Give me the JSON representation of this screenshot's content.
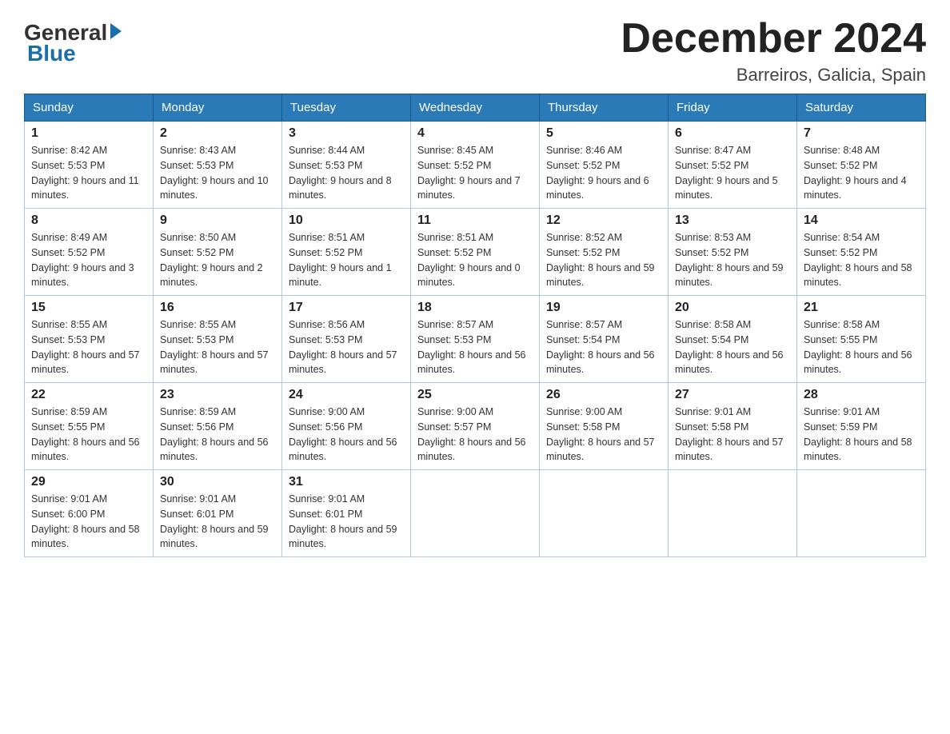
{
  "header": {
    "logo_general": "General",
    "logo_blue": "Blue",
    "month_title": "December 2024",
    "location": "Barreiros, Galicia, Spain"
  },
  "days_of_week": [
    "Sunday",
    "Monday",
    "Tuesday",
    "Wednesday",
    "Thursday",
    "Friday",
    "Saturday"
  ],
  "weeks": [
    [
      {
        "num": "1",
        "sunrise": "8:42 AM",
        "sunset": "5:53 PM",
        "daylight": "9 hours and 11 minutes."
      },
      {
        "num": "2",
        "sunrise": "8:43 AM",
        "sunset": "5:53 PM",
        "daylight": "9 hours and 10 minutes."
      },
      {
        "num": "3",
        "sunrise": "8:44 AM",
        "sunset": "5:53 PM",
        "daylight": "9 hours and 8 minutes."
      },
      {
        "num": "4",
        "sunrise": "8:45 AM",
        "sunset": "5:52 PM",
        "daylight": "9 hours and 7 minutes."
      },
      {
        "num": "5",
        "sunrise": "8:46 AM",
        "sunset": "5:52 PM",
        "daylight": "9 hours and 6 minutes."
      },
      {
        "num": "6",
        "sunrise": "8:47 AM",
        "sunset": "5:52 PM",
        "daylight": "9 hours and 5 minutes."
      },
      {
        "num": "7",
        "sunrise": "8:48 AM",
        "sunset": "5:52 PM",
        "daylight": "9 hours and 4 minutes."
      }
    ],
    [
      {
        "num": "8",
        "sunrise": "8:49 AM",
        "sunset": "5:52 PM",
        "daylight": "9 hours and 3 minutes."
      },
      {
        "num": "9",
        "sunrise": "8:50 AM",
        "sunset": "5:52 PM",
        "daylight": "9 hours and 2 minutes."
      },
      {
        "num": "10",
        "sunrise": "8:51 AM",
        "sunset": "5:52 PM",
        "daylight": "9 hours and 1 minute."
      },
      {
        "num": "11",
        "sunrise": "8:51 AM",
        "sunset": "5:52 PM",
        "daylight": "9 hours and 0 minutes."
      },
      {
        "num": "12",
        "sunrise": "8:52 AM",
        "sunset": "5:52 PM",
        "daylight": "8 hours and 59 minutes."
      },
      {
        "num": "13",
        "sunrise": "8:53 AM",
        "sunset": "5:52 PM",
        "daylight": "8 hours and 59 minutes."
      },
      {
        "num": "14",
        "sunrise": "8:54 AM",
        "sunset": "5:52 PM",
        "daylight": "8 hours and 58 minutes."
      }
    ],
    [
      {
        "num": "15",
        "sunrise": "8:55 AM",
        "sunset": "5:53 PM",
        "daylight": "8 hours and 57 minutes."
      },
      {
        "num": "16",
        "sunrise": "8:55 AM",
        "sunset": "5:53 PM",
        "daylight": "8 hours and 57 minutes."
      },
      {
        "num": "17",
        "sunrise": "8:56 AM",
        "sunset": "5:53 PM",
        "daylight": "8 hours and 57 minutes."
      },
      {
        "num": "18",
        "sunrise": "8:57 AM",
        "sunset": "5:53 PM",
        "daylight": "8 hours and 56 minutes."
      },
      {
        "num": "19",
        "sunrise": "8:57 AM",
        "sunset": "5:54 PM",
        "daylight": "8 hours and 56 minutes."
      },
      {
        "num": "20",
        "sunrise": "8:58 AM",
        "sunset": "5:54 PM",
        "daylight": "8 hours and 56 minutes."
      },
      {
        "num": "21",
        "sunrise": "8:58 AM",
        "sunset": "5:55 PM",
        "daylight": "8 hours and 56 minutes."
      }
    ],
    [
      {
        "num": "22",
        "sunrise": "8:59 AM",
        "sunset": "5:55 PM",
        "daylight": "8 hours and 56 minutes."
      },
      {
        "num": "23",
        "sunrise": "8:59 AM",
        "sunset": "5:56 PM",
        "daylight": "8 hours and 56 minutes."
      },
      {
        "num": "24",
        "sunrise": "9:00 AM",
        "sunset": "5:56 PM",
        "daylight": "8 hours and 56 minutes."
      },
      {
        "num": "25",
        "sunrise": "9:00 AM",
        "sunset": "5:57 PM",
        "daylight": "8 hours and 56 minutes."
      },
      {
        "num": "26",
        "sunrise": "9:00 AM",
        "sunset": "5:58 PM",
        "daylight": "8 hours and 57 minutes."
      },
      {
        "num": "27",
        "sunrise": "9:01 AM",
        "sunset": "5:58 PM",
        "daylight": "8 hours and 57 minutes."
      },
      {
        "num": "28",
        "sunrise": "9:01 AM",
        "sunset": "5:59 PM",
        "daylight": "8 hours and 58 minutes."
      }
    ],
    [
      {
        "num": "29",
        "sunrise": "9:01 AM",
        "sunset": "6:00 PM",
        "daylight": "8 hours and 58 minutes."
      },
      {
        "num": "30",
        "sunrise": "9:01 AM",
        "sunset": "6:01 PM",
        "daylight": "8 hours and 59 minutes."
      },
      {
        "num": "31",
        "sunrise": "9:01 AM",
        "sunset": "6:01 PM",
        "daylight": "8 hours and 59 minutes."
      },
      null,
      null,
      null,
      null
    ]
  ]
}
